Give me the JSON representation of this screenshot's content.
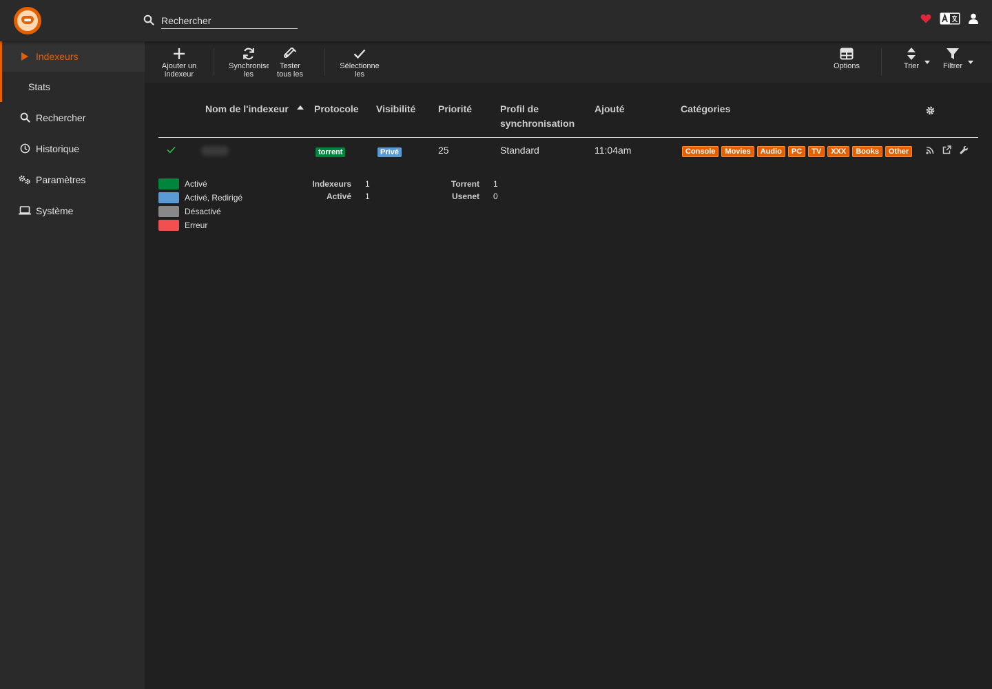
{
  "header": {
    "search": {
      "placeholder": "Rechercher"
    }
  },
  "sidebar": {
    "items": [
      {
        "label": "Indexeurs",
        "active": true
      },
      {
        "label": "Stats"
      },
      {
        "label": "Rechercher"
      },
      {
        "label": "Historique"
      },
      {
        "label": "Paramètres"
      },
      {
        "label": "Système"
      }
    ]
  },
  "toolbar": {
    "add": "Ajouter un indexeur",
    "sync": "Synchronise les",
    "test": "Tester tous les",
    "select": "Sélectionne les",
    "options": "Options",
    "sort": "Trier",
    "filter": "Filtrer"
  },
  "table": {
    "columns": {
      "name": "Nom de l'indexeur",
      "protocol": "Protocole",
      "visibility": "Visibilité",
      "priority": "Priorité",
      "sync_profile": "Profil de synchronisation",
      "added": "Ajouté",
      "categories": "Catégories"
    },
    "rows": [
      {
        "protocol": "torrent",
        "visibility": "Privé",
        "priority": "25",
        "sync_profile": "Standard",
        "added": "11:04am",
        "categories": [
          "Console",
          "Movies",
          "Audio",
          "PC",
          "TV",
          "XXX",
          "Books",
          "Other"
        ]
      }
    ]
  },
  "legend": [
    {
      "label": "Activé",
      "color": "#00853d"
    },
    {
      "label": "Activé, Redirigé",
      "color": "#5b9bd5"
    },
    {
      "label": "Désactivé",
      "color": "#888888"
    },
    {
      "label": "Erreur",
      "color": "#f05050"
    }
  ],
  "stats": {
    "indexers_label": "Indexeurs",
    "indexers": "1",
    "enabled_label": "Activé",
    "enabled": "1",
    "torrent_label": "Torrent",
    "torrent": "1",
    "usenet_label": "Usenet",
    "usenet": "0"
  },
  "colors": {
    "accent": "#e66000",
    "heart": "#e0263a"
  }
}
